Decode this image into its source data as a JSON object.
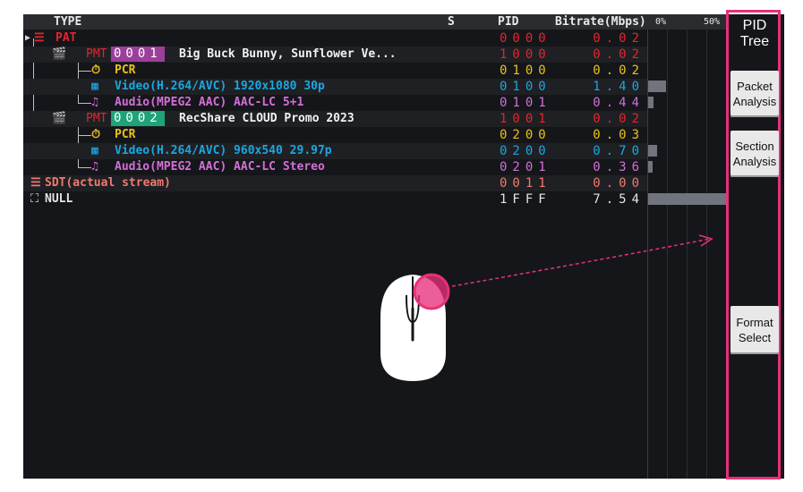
{
  "header": {
    "type": "TYPE",
    "s": "S",
    "pid": "PID",
    "bitrate": "Bitrate(Mbps)",
    "pct0": "0%",
    "pct50": "50%"
  },
  "rows": [
    {
      "kind": "PAT",
      "label": "PAT",
      "pid": "0000",
      "rate": "0.02",
      "color": "#e2262b"
    },
    {
      "kind": "PMT",
      "label": "PMT",
      "chip": "0001",
      "chip_color": "#9b3f9a",
      "desc": "Big Buck Bunny, Sunflower Ve...",
      "pid": "1000",
      "rate": "0.02",
      "color": "#e2262b"
    },
    {
      "kind": "PCR",
      "label": "PCR",
      "pid": "0100",
      "rate": "0.02",
      "color": "#ecc11b"
    },
    {
      "kind": "Video",
      "label": "Video(H.264/AVC) 1920x1080 30p",
      "pid": "0100",
      "rate": "1.40",
      "color": "#1aa7e0"
    },
    {
      "kind": "Audio",
      "label": "Audio(MPEG2 AAC) AAC-LC 5+1",
      "pid": "0101",
      "rate": "0.44",
      "color": "#d36fd8"
    },
    {
      "kind": "PMT",
      "label": "PMT",
      "chip": "0002",
      "chip_color": "#1ea37a",
      "desc": "RecShare CLOUD Promo 2023",
      "pid": "1001",
      "rate": "0.02",
      "color": "#e2262b"
    },
    {
      "kind": "PCR",
      "label": "PCR",
      "pid": "0200",
      "rate": "0.03",
      "color": "#ecc11b"
    },
    {
      "kind": "Video",
      "label": "Video(H.264/AVC) 960x540 29.97p",
      "pid": "0200",
      "rate": "0.70",
      "color": "#1aa7e0"
    },
    {
      "kind": "Audio",
      "label": "Audio(MPEG2 AAC) AAC-LC Stereo",
      "pid": "0201",
      "rate": "0.36",
      "color": "#d36fd8"
    },
    {
      "kind": "SDT",
      "label": "SDT(actual stream)",
      "pid": "0011",
      "rate": "0.00",
      "color": "#ee7b6f"
    },
    {
      "kind": "NULL",
      "label": "NULL",
      "pid": "1FFF",
      "rate": "7.54",
      "color": "#e4e4e4"
    }
  ],
  "bars": [
    0.0,
    0.0,
    0.0,
    0.19,
    0.06,
    0.0,
    0.0,
    0.09,
    0.05,
    0.0,
    1.0
  ],
  "sidebar": {
    "pid_tree": [
      "PID",
      "Tree"
    ],
    "packet_analysis": [
      "Packet",
      "Analysis"
    ],
    "section_analysis": [
      "Section",
      "Analysis"
    ],
    "format_select": [
      "Format",
      "Select"
    ]
  },
  "colors": {
    "highlight": "#e8307a",
    "background": "#15161a"
  }
}
